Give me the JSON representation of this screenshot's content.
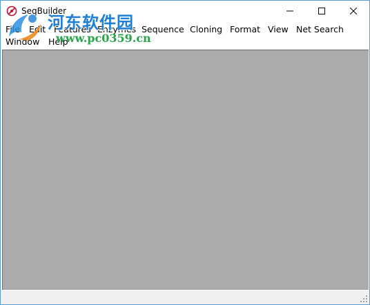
{
  "window": {
    "title": "SeqBuilder",
    "controls": {
      "minimize": "minimize-icon",
      "maximize": "maximize-icon",
      "close": "close-icon"
    }
  },
  "watermark": {
    "title": "河东软件园",
    "url": "www.pc0359.cn"
  },
  "menu": {
    "items": [
      "File",
      "Edit",
      "Features",
      "Enzymes",
      "Sequence",
      "Cloning",
      "Format",
      "View",
      "Net Search",
      "Window",
      "Help"
    ]
  },
  "colors": {
    "workspace": "#ababab",
    "window_border": "#5b9bd5",
    "watermark_blue": "#1d7fd6",
    "watermark_green": "#2aa34a"
  }
}
